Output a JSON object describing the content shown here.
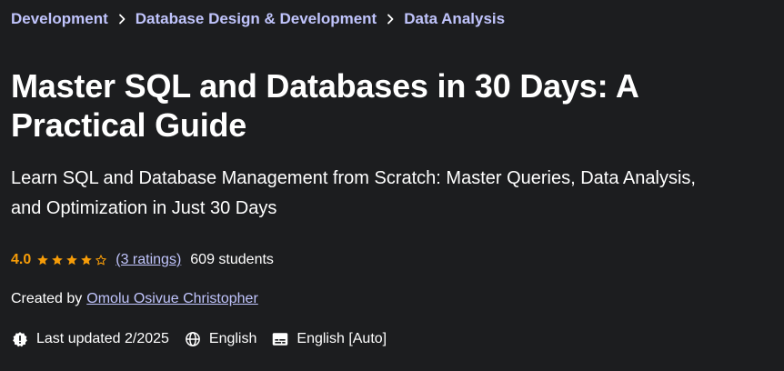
{
  "breadcrumb": {
    "items": [
      "Development",
      "Database Design & Development",
      "Data Analysis"
    ]
  },
  "course": {
    "title_line1": "Master SQL and Databases in 30 Days: A",
    "title_line2": "Practical Guide",
    "subtitle_line1": "Learn SQL and Database Management from Scratch: Master Queries, Data Analysis,",
    "subtitle_line2": "and Optimization in Just 30 Days"
  },
  "rating": {
    "value": "4.0",
    "stars_filled": 4,
    "stars_total": 5,
    "ratings_text": "(3 ratings)",
    "students_text": "609 students"
  },
  "creator": {
    "label": "Created by",
    "name": "Omolu Osivue Christopher"
  },
  "meta": {
    "last_updated": "Last updated 2/2025",
    "language": "English",
    "captions": "English [Auto]"
  },
  "icons": {
    "chevron": "chevron-right-icon",
    "star_full": "star-full-icon",
    "star_empty": "star-empty-icon",
    "updated": "alert-badge-icon",
    "language": "globe-icon",
    "captions": "captions-icon"
  },
  "colors": {
    "background": "#1c1d1f",
    "link": "#c0c4fc",
    "rating": "#f69c08",
    "text": "#ffffff"
  }
}
